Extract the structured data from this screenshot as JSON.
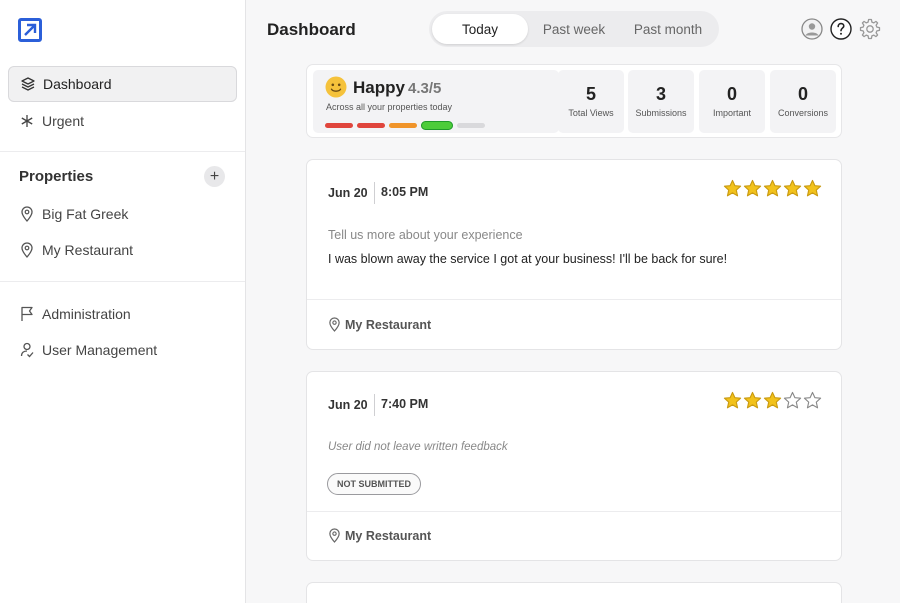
{
  "app": {
    "brand_color": "#2b5fd9"
  },
  "sidebar": {
    "main_items": [
      {
        "label": "Dashboard",
        "icon": "layers-icon",
        "active": true
      },
      {
        "label": "Urgent",
        "icon": "asterisk-icon",
        "active": false
      }
    ],
    "properties_title": "Properties",
    "properties": [
      {
        "label": "Big Fat Greek",
        "icon": "map-pin-icon"
      },
      {
        "label": "My Restaurant",
        "icon": "map-pin-icon"
      }
    ],
    "admin_items": [
      {
        "label": "Administration",
        "icon": "flag-icon"
      },
      {
        "label": "User Management",
        "icon": "user-check-icon"
      }
    ]
  },
  "header": {
    "title": "Dashboard",
    "ranges": [
      {
        "label": "Today",
        "selected": true
      },
      {
        "label": "Past week",
        "selected": false
      },
      {
        "label": "Past month",
        "selected": false
      }
    ]
  },
  "summary": {
    "mood_label": "Happy",
    "mood_score": "4.3/5",
    "mood_subtitle": "Across all your properties today",
    "mood_scale_colors": [
      "#e0453c",
      "#e0453c",
      "#f0942a",
      "#4ccc3a",
      "#d9d9dc"
    ],
    "mood_selected_index": 3,
    "stats": [
      {
        "value": "5",
        "label": "Total Views"
      },
      {
        "value": "3",
        "label": "Submissions"
      },
      {
        "value": "0",
        "label": "Important"
      },
      {
        "value": "0",
        "label": "Conversions"
      }
    ]
  },
  "feedback": [
    {
      "date": "Jun 20",
      "time": "8:05 PM",
      "rating": 5,
      "question": "Tell us more about your experience",
      "answer": "I was blown away the service I got at your business! I'll be back for sure!",
      "property": "My Restaurant"
    },
    {
      "date": "Jun 20",
      "time": "7:40 PM",
      "rating": 3,
      "no_feedback": "User did not leave written feedback",
      "status_badge": "NOT SUBMITTED",
      "property": "My Restaurant"
    }
  ],
  "star_color": "#f2c21b"
}
